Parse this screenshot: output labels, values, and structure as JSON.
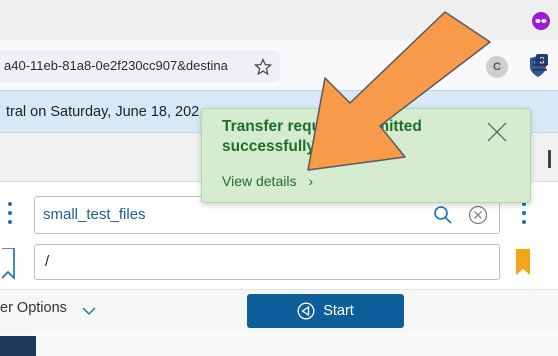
{
  "browser": {
    "url": "a40-11eb-81a8-0e2f230cc907&destina",
    "extension_badge": "3",
    "extension_letter": "C"
  },
  "banner": {
    "text": "tral on Saturday, June 18, 202"
  },
  "form": {
    "collection_value": "small_test_files",
    "path_value": "/",
    "options_label": "er Options",
    "start_label": "Start"
  },
  "toast": {
    "message": "Transfer request submitted successfully",
    "link_label": "View details",
    "link_chevron": "›"
  },
  "colors": {
    "toast_bg": "#d6ecd1",
    "toast_text": "#1e6e2a",
    "start_button": "#0f5e9c",
    "banner_bg": "#d7e9f7",
    "annotation_arrow": "#f79a4a",
    "bookmark": "#f2a516"
  }
}
